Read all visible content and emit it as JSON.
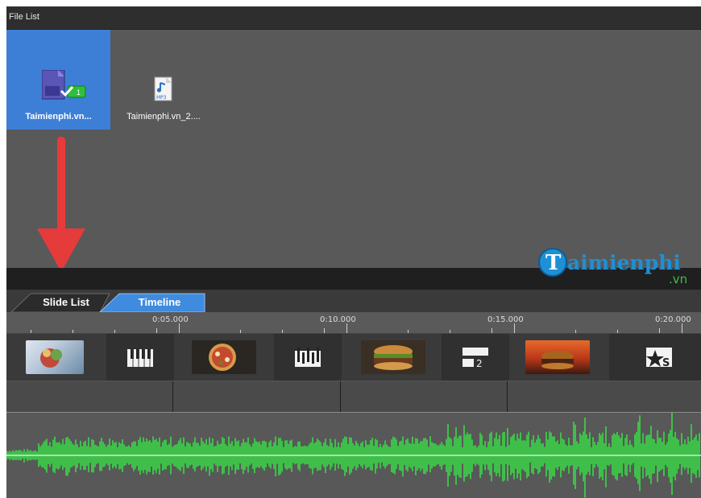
{
  "file_list": {
    "title": "File List",
    "items": [
      {
        "name": "Taimienphi.vn...",
        "icon": "video-file-icon",
        "selected": true,
        "badge": "1"
      },
      {
        "name": "Taimienphi.vn_2....",
        "icon": "mp3-file-icon",
        "selected": false,
        "badge_text": "MP3"
      }
    ]
  },
  "watermark": {
    "main": "aimienphi",
    "suffix": ".vn",
    "logo_letter": "T"
  },
  "tabs": [
    {
      "label": "Slide List",
      "active": false
    },
    {
      "label": "Timeline",
      "active": true
    }
  ],
  "ruler": {
    "labels": [
      "0:05.000",
      "0:10.000",
      "0:15.000",
      "0:20.000"
    ]
  },
  "slides": [
    {
      "kind": "photo",
      "icon": "food-photo-icon"
    },
    {
      "kind": "transition",
      "icon": "piano-transition-icon"
    },
    {
      "kind": "photo",
      "icon": "pizza-photo-icon"
    },
    {
      "kind": "transition",
      "icon": "bars-transition-icon"
    },
    {
      "kind": "photo",
      "icon": "burger-photo-icon"
    },
    {
      "kind": "transition",
      "icon": "split-transition-icon",
      "label": "2"
    },
    {
      "kind": "photo",
      "icon": "burger-fire-photo-icon"
    },
    {
      "kind": "transition",
      "icon": "star-transition-icon",
      "label": "S"
    }
  ],
  "colors": {
    "selection": "#3d7fd6",
    "active_tab": "#3f8be0",
    "arrow": "#e63b3b",
    "waveform": "#3fbf4a",
    "waveform_center": "#c8f0c8",
    "watermark_blue": "#1e90d6"
  }
}
